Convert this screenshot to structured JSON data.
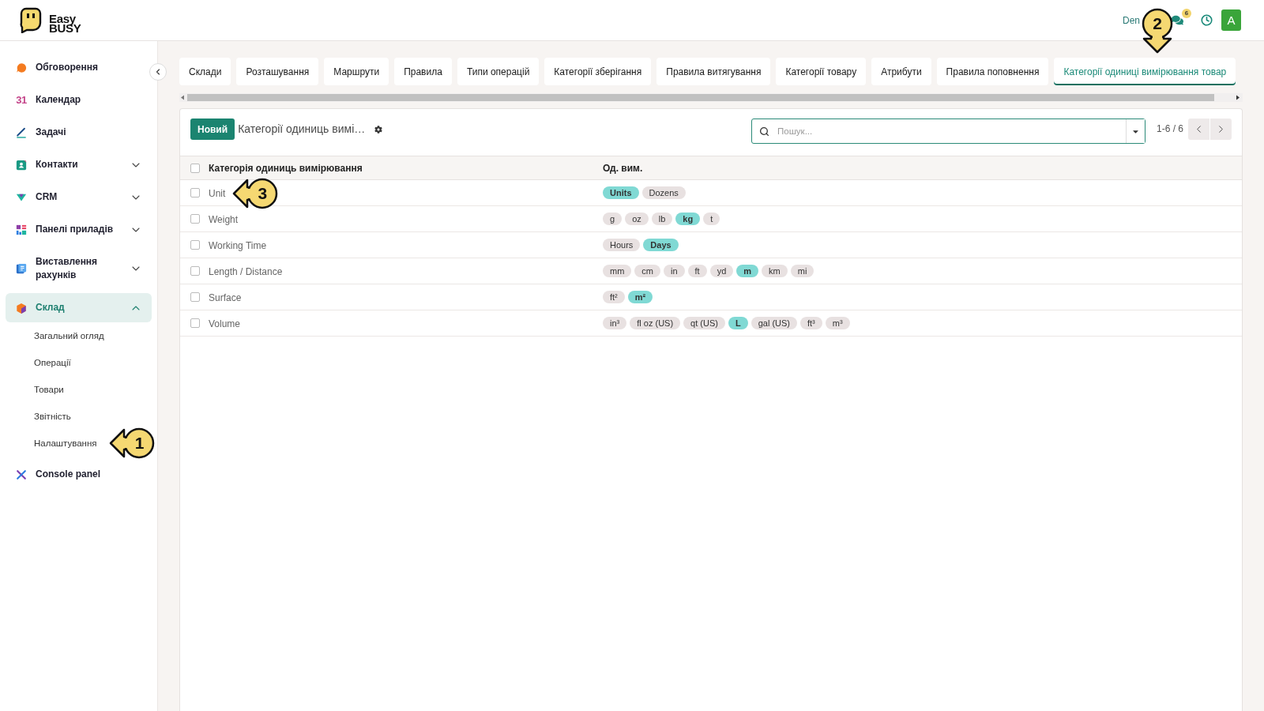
{
  "header": {
    "logo": {
      "line_1": "Easy",
      "line_2": "BUSY"
    },
    "user": "Den",
    "callout": {
      "number": "2",
      "kind": "down"
    },
    "notification_count": "6",
    "avatar": "A"
  },
  "sidebar": {
    "items": [
      {
        "label": "Обговорення",
        "selected": false
      },
      {
        "label": "Календар",
        "glyph": "31",
        "selected": false
      },
      {
        "label": "Задачі",
        "selected": false
      },
      {
        "label": "Контакти",
        "selected": false,
        "expanded": false
      },
      {
        "label": "CRM",
        "selected": false,
        "expanded": false
      },
      {
        "label": "Панелі приладів",
        "selected": false,
        "expanded": false
      },
      {
        "label": "Виставлення рахунків",
        "selected": false,
        "expanded": false
      },
      {
        "label": "Склад",
        "selected": true,
        "expanded": true,
        "children": [
          {
            "label": "Загальний огляд",
            "selected": false
          },
          {
            "label": "Операції",
            "selected": false
          },
          {
            "label": "Товари",
            "selected": false
          },
          {
            "label": "Звітність",
            "selected": false
          },
          {
            "label": "Налаштування",
            "selected": false,
            "callout": {
              "number": "1",
              "kind": "left"
            }
          }
        ]
      },
      {
        "label": "Console panel",
        "selected": false
      }
    ]
  },
  "tabs": [
    {
      "label": "Склади",
      "selected": false
    },
    {
      "label": "Розташування",
      "selected": false
    },
    {
      "label": "Маршрути",
      "selected": false
    },
    {
      "label": "Правила",
      "selected": false
    },
    {
      "label": "Типи операцій",
      "selected": false
    },
    {
      "label": "Категорії зберігання",
      "selected": false
    },
    {
      "label": "Правила витягування",
      "selected": false
    },
    {
      "label": "Категорії товару",
      "selected": false
    },
    {
      "label": "Атрибути",
      "selected": false
    },
    {
      "label": "Правила поповнення",
      "selected": false
    },
    {
      "label": "Категорії одиниці вимірювання товар",
      "selected": true
    }
  ],
  "toolbar": {
    "new_button": "Новий",
    "title": "Категорії одиниць вимі…",
    "search": {
      "placeholder": "Пошук..."
    },
    "pager": "1-6 / 6"
  },
  "table": {
    "header_checked": false,
    "columns": [
      "Категорія одиниць вимірювання",
      "Од. вим."
    ],
    "rows": [
      {
        "checked": false,
        "name": "Unit",
        "callout": {
          "number": "3",
          "kind": "left"
        },
        "units": [
          {
            "label": "Units",
            "highlighted": true
          },
          {
            "label": "Dozens",
            "highlighted": false
          }
        ]
      },
      {
        "checked": false,
        "name": "Weight",
        "units": [
          {
            "label": "g",
            "highlighted": false
          },
          {
            "label": "oz",
            "highlighted": false
          },
          {
            "label": "lb",
            "highlighted": false
          },
          {
            "label": "kg",
            "highlighted": true
          },
          {
            "label": "t",
            "highlighted": false
          }
        ]
      },
      {
        "checked": false,
        "name": "Working Time",
        "units": [
          {
            "label": "Hours",
            "highlighted": false
          },
          {
            "label": "Days",
            "highlighted": true
          }
        ]
      },
      {
        "checked": false,
        "name": "Length / Distance",
        "units": [
          {
            "label": "mm",
            "highlighted": false
          },
          {
            "label": "cm",
            "highlighted": false
          },
          {
            "label": "in",
            "highlighted": false
          },
          {
            "label": "ft",
            "highlighted": false
          },
          {
            "label": "yd",
            "highlighted": false
          },
          {
            "label": "m",
            "highlighted": true
          },
          {
            "label": "km",
            "highlighted": false
          },
          {
            "label": "mi",
            "highlighted": false
          }
        ]
      },
      {
        "checked": false,
        "name": "Surface",
        "units": [
          {
            "label": "ft²",
            "highlighted": false
          },
          {
            "label": "m²",
            "highlighted": true
          }
        ]
      },
      {
        "checked": false,
        "name": "Volume",
        "units": [
          {
            "label": "in³",
            "highlighted": false
          },
          {
            "label": "fl oz (US)",
            "highlighted": false
          },
          {
            "label": "qt (US)",
            "highlighted": false
          },
          {
            "label": "L",
            "highlighted": true
          },
          {
            "label": "gal (US)",
            "highlighted": false
          },
          {
            "label": "ft³",
            "highlighted": false
          },
          {
            "label": "m³",
            "highlighted": false
          }
        ]
      }
    ]
  }
}
